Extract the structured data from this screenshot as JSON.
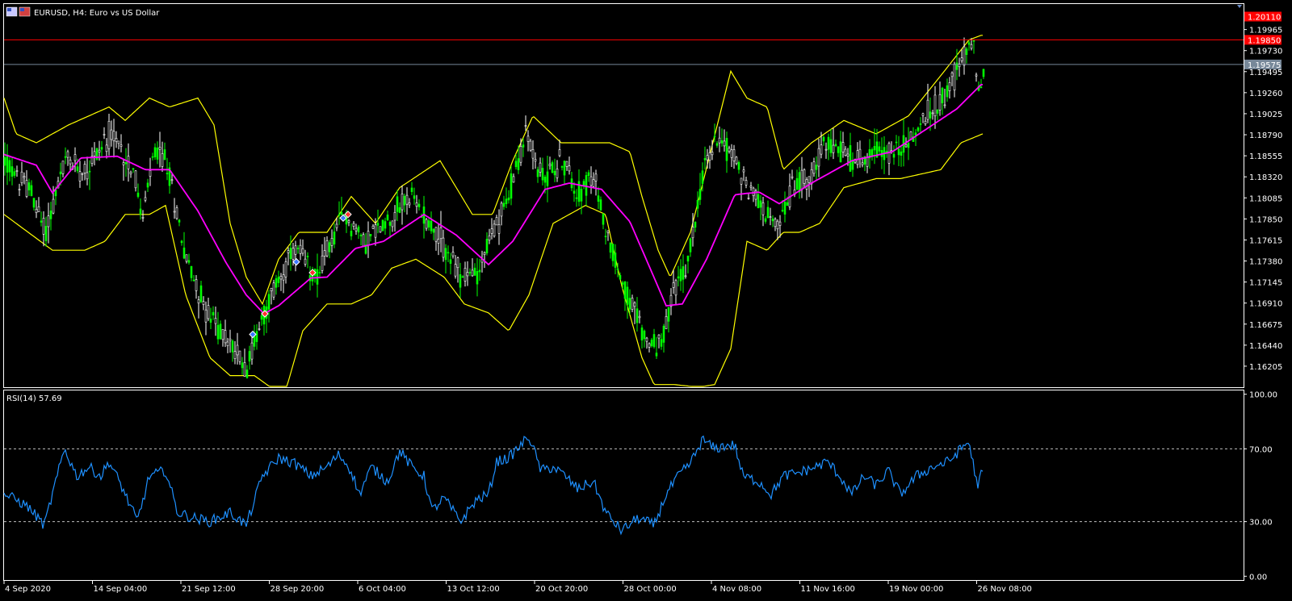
{
  "window": {
    "title": "EURUSD, H4:  Euro vs US Dollar"
  },
  "colors": {
    "background": "#000000",
    "frame": "#ffffff",
    "bull_candle": "#00ff00",
    "bear_candle": "#ffffff",
    "moving_average": "#ff00ff",
    "bollinger": "#ffff00",
    "rsi_line": "#1e90ff",
    "level_line": "#c0c0c0",
    "ask_line": "#ff0000",
    "bid_line": "#778899"
  },
  "chart_data": [
    {
      "type": "candlestick",
      "symbol": "EURUSD",
      "timeframe": "H4",
      "ylim": [
        1.1597,
        1.2025
      ],
      "y_ticks": [
        "1.19965",
        "1.19730",
        "1.19495",
        "1.19260",
        "1.19025",
        "1.18790",
        "1.18555",
        "1.18320",
        "1.18085",
        "1.17850",
        "1.17615",
        "1.17380",
        "1.17145",
        "1.16910",
        "1.16675",
        "1.16440",
        "1.16205"
      ],
      "x_ticks": [
        "4 Sep 2020",
        "14 Sep 04:00",
        "21 Sep 12:00",
        "28 Sep 20:00",
        "6 Oct 04:00",
        "13 Oct 12:00",
        "20 Oct 20:00",
        "28 Oct 00:00",
        "4 Nov 08:00",
        "11 Nov 16:00",
        "19 Nov 00:00",
        "26 Nov 08:00"
      ],
      "price_tags": [
        {
          "label": "1.20110",
          "value": 1.2011,
          "color": "#ff0000"
        },
        {
          "label": "1.19850",
          "value": 1.1985,
          "color": "#ff0000"
        },
        {
          "label": "1.19575",
          "value": 1.19575,
          "color": "#778899"
        }
      ],
      "ask": 1.1985,
      "bid": 1.19575,
      "ma_anchors": [
        [
          0,
          1.1857
        ],
        [
          40,
          1.1845
        ],
        [
          60,
          1.1814
        ],
        [
          95,
          1.1853
        ],
        [
          140,
          1.1855
        ],
        [
          175,
          1.184
        ],
        [
          205,
          1.184
        ],
        [
          240,
          1.1794
        ],
        [
          275,
          1.1736
        ],
        [
          300,
          1.17
        ],
        [
          322,
          1.1679
        ],
        [
          340,
          1.1688
        ],
        [
          380,
          1.1719
        ],
        [
          400,
          1.172
        ],
        [
          435,
          1.1752
        ],
        [
          470,
          1.176
        ],
        [
          520,
          1.179
        ],
        [
          560,
          1.1767
        ],
        [
          600,
          1.1734
        ],
        [
          630,
          1.176
        ],
        [
          670,
          1.1818
        ],
        [
          700,
          1.1825
        ],
        [
          740,
          1.1818
        ],
        [
          775,
          1.1782
        ],
        [
          800,
          1.173
        ],
        [
          820,
          1.1688
        ],
        [
          840,
          1.169
        ],
        [
          870,
          1.174
        ],
        [
          905,
          1.1812
        ],
        [
          935,
          1.1815
        ],
        [
          960,
          1.1802
        ],
        [
          1000,
          1.1825
        ],
        [
          1050,
          1.185
        ],
        [
          1100,
          1.186
        ],
        [
          1150,
          1.189
        ],
        [
          1180,
          1.1908
        ],
        [
          1210,
          1.1935
        ]
      ],
      "candle_anchors": [
        [
          0,
          1.185
        ],
        [
          15,
          1.183
        ],
        [
          30,
          1.182
        ],
        [
          50,
          1.177
        ],
        [
          75,
          1.185
        ],
        [
          100,
          1.184
        ],
        [
          130,
          1.188
        ],
        [
          160,
          1.184
        ],
        [
          170,
          1.178
        ],
        [
          185,
          1.186
        ],
        [
          200,
          1.185
        ],
        [
          225,
          1.174
        ],
        [
          250,
          1.168
        ],
        [
          275,
          1.165
        ],
        [
          300,
          1.162
        ],
        [
          315,
          1.1665
        ],
        [
          340,
          1.172
        ],
        [
          360,
          1.175
        ],
        [
          385,
          1.172
        ],
        [
          405,
          1.176
        ],
        [
          420,
          1.179
        ],
        [
          445,
          1.176
        ],
        [
          470,
          1.178
        ],
        [
          500,
          1.181
        ],
        [
          520,
          1.179
        ],
        [
          540,
          1.176
        ],
        [
          565,
          1.172
        ],
        [
          585,
          1.1725
        ],
        [
          600,
          1.176
        ],
        [
          620,
          1.18
        ],
        [
          645,
          1.188
        ],
        [
          665,
          1.183
        ],
        [
          690,
          1.185
        ],
        [
          710,
          1.1815
        ],
        [
          730,
          1.183
        ],
        [
          745,
          1.177
        ],
        [
          770,
          1.17
        ],
        [
          800,
          1.164
        ],
        [
          815,
          1.165
        ],
        [
          830,
          1.171
        ],
        [
          845,
          1.173
        ],
        [
          865,
          1.184
        ],
        [
          885,
          1.188
        ],
        [
          905,
          1.185
        ],
        [
          920,
          1.182
        ],
        [
          940,
          1.18
        ],
        [
          955,
          1.177
        ],
        [
          975,
          1.182
        ],
        [
          1000,
          1.184
        ],
        [
          1020,
          1.187
        ],
        [
          1050,
          1.185
        ],
        [
          1080,
          1.186
        ],
        [
          1100,
          1.186
        ],
        [
          1120,
          1.187
        ],
        [
          1140,
          1.19
        ],
        [
          1160,
          1.192
        ],
        [
          1180,
          1.195
        ],
        [
          1200,
          1.199
        ],
        [
          1205,
          1.1925
        ],
        [
          1212,
          1.1945
        ]
      ],
      "bb_upper_anchors": [
        [
          0,
          1.192
        ],
        [
          15,
          1.188
        ],
        [
          40,
          1.187
        ],
        [
          80,
          1.189
        ],
        [
          130,
          1.191
        ],
        [
          150,
          1.1895
        ],
        [
          180,
          1.192
        ],
        [
          205,
          1.191
        ],
        [
          240,
          1.192
        ],
        [
          260,
          1.189
        ],
        [
          280,
          1.178
        ],
        [
          300,
          1.172
        ],
        [
          320,
          1.169
        ],
        [
          340,
          1.174
        ],
        [
          365,
          1.177
        ],
        [
          400,
          1.177
        ],
        [
          430,
          1.181
        ],
        [
          460,
          1.178
        ],
        [
          490,
          1.182
        ],
        [
          540,
          1.185
        ],
        [
          560,
          1.182
        ],
        [
          580,
          1.179
        ],
        [
          605,
          1.179
        ],
        [
          630,
          1.185
        ],
        [
          655,
          1.19
        ],
        [
          690,
          1.187
        ],
        [
          720,
          1.187
        ],
        [
          750,
          1.187
        ],
        [
          775,
          1.186
        ],
        [
          790,
          1.181
        ],
        [
          810,
          1.175
        ],
        [
          825,
          1.172
        ],
        [
          850,
          1.177
        ],
        [
          875,
          1.186
        ],
        [
          900,
          1.195
        ],
        [
          920,
          1.192
        ],
        [
          945,
          1.191
        ],
        [
          965,
          1.184
        ],
        [
          1000,
          1.187
        ],
        [
          1040,
          1.1895
        ],
        [
          1080,
          1.188
        ],
        [
          1120,
          1.19
        ],
        [
          1160,
          1.1945
        ],
        [
          1195,
          1.1985
        ],
        [
          1210,
          1.199
        ]
      ],
      "bb_lower_anchors": [
        [
          0,
          1.179
        ],
        [
          30,
          1.177
        ],
        [
          60,
          1.175
        ],
        [
          100,
          1.175
        ],
        [
          125,
          1.176
        ],
        [
          150,
          1.179
        ],
        [
          180,
          1.179
        ],
        [
          200,
          1.18
        ],
        [
          225,
          1.17
        ],
        [
          255,
          1.163
        ],
        [
          280,
          1.161
        ],
        [
          310,
          1.161
        ],
        [
          330,
          1.1597
        ],
        [
          350,
          1.1597
        ],
        [
          370,
          1.166
        ],
        [
          400,
          1.169
        ],
        [
          430,
          1.169
        ],
        [
          455,
          1.17
        ],
        [
          480,
          1.173
        ],
        [
          510,
          1.174
        ],
        [
          545,
          1.172
        ],
        [
          570,
          1.169
        ],
        [
          600,
          1.168
        ],
        [
          625,
          1.166
        ],
        [
          650,
          1.17
        ],
        [
          680,
          1.178
        ],
        [
          720,
          1.18
        ],
        [
          745,
          1.179
        ],
        [
          765,
          1.171
        ],
        [
          790,
          1.163
        ],
        [
          805,
          1.16
        ],
        [
          830,
          1.16
        ],
        [
          860,
          1.1597
        ],
        [
          880,
          1.16
        ],
        [
          900,
          1.164
        ],
        [
          920,
          1.176
        ],
        [
          945,
          1.175
        ],
        [
          965,
          1.177
        ],
        [
          985,
          1.177
        ],
        [
          1010,
          1.178
        ],
        [
          1040,
          1.182
        ],
        [
          1080,
          1.183
        ],
        [
          1110,
          1.183
        ],
        [
          1160,
          1.184
        ],
        [
          1185,
          1.187
        ],
        [
          1212,
          1.188
        ]
      ],
      "signals": [
        {
          "i": 308,
          "price": 1.1656,
          "kind": "buy"
        },
        {
          "i": 323,
          "price": 1.1679,
          "kind": "sell"
        },
        {
          "i": 362,
          "price": 1.1737,
          "kind": "buy"
        },
        {
          "i": 382,
          "price": 1.1725,
          "kind": "sell"
        },
        {
          "i": 420,
          "price": 1.1786,
          "kind": "buy"
        },
        {
          "i": 426,
          "price": 1.179,
          "kind": "sell"
        }
      ]
    },
    {
      "type": "line",
      "title": "RSI(14) 57.69",
      "ylim": [
        0,
        100
      ],
      "y_ticks": [
        "100.00",
        "70.00",
        "30.00",
        "0.00"
      ],
      "levels": [
        70,
        30
      ],
      "series": [
        {
          "name": "RSI(14)",
          "points": [
            [
              0,
              45
            ],
            [
              15,
              42
            ],
            [
              30,
              38
            ],
            [
              50,
              28
            ],
            [
              60,
              45
            ],
            [
              75,
              70
            ],
            [
              90,
              55
            ],
            [
              105,
              60
            ],
            [
              120,
              55
            ],
            [
              130,
              63
            ],
            [
              145,
              50
            ],
            [
              165,
              30
            ],
            [
              180,
              55
            ],
            [
              200,
              58
            ],
            [
              215,
              35
            ],
            [
              235,
              32
            ],
            [
              255,
              30
            ],
            [
              280,
              35
            ],
            [
              300,
              28
            ],
            [
              320,
              55
            ],
            [
              340,
              65
            ],
            [
              360,
              62
            ],
            [
              380,
              55
            ],
            [
              400,
              60
            ],
            [
              415,
              67
            ],
            [
              430,
              58
            ],
            [
              440,
              45
            ],
            [
              455,
              60
            ],
            [
              475,
              52
            ],
            [
              490,
              69
            ],
            [
              505,
              60
            ],
            [
              520,
              55
            ],
            [
              530,
              36
            ],
            [
              545,
              43
            ],
            [
              565,
              30
            ],
            [
              585,
              42
            ],
            [
              600,
              45
            ],
            [
              610,
              63
            ],
            [
              625,
              65
            ],
            [
              640,
              72
            ],
            [
              650,
              77
            ],
            [
              665,
              58
            ],
            [
              680,
              60
            ],
            [
              695,
              55
            ],
            [
              710,
              48
            ],
            [
              730,
              52
            ],
            [
              745,
              35
            ],
            [
              765,
              25
            ],
            [
              785,
              32
            ],
            [
              805,
              28
            ],
            [
              820,
              45
            ],
            [
              835,
              55
            ],
            [
              850,
              62
            ],
            [
              865,
              75
            ],
            [
              880,
              70
            ],
            [
              895,
              72
            ],
            [
              905,
              72
            ],
            [
              915,
              55
            ],
            [
              935,
              52
            ],
            [
              950,
              45
            ],
            [
              965,
              55
            ],
            [
              985,
              57
            ],
            [
              1005,
              60
            ],
            [
              1020,
              63
            ],
            [
              1035,
              55
            ],
            [
              1050,
              45
            ],
            [
              1065,
              55
            ],
            [
              1080,
              50
            ],
            [
              1095,
              58
            ],
            [
              1110,
              45
            ],
            [
              1130,
              55
            ],
            [
              1150,
              60
            ],
            [
              1170,
              63
            ],
            [
              1185,
              70
            ],
            [
              1195,
              74
            ],
            [
              1205,
              50
            ],
            [
              1212,
              57.69
            ]
          ]
        }
      ]
    }
  ]
}
